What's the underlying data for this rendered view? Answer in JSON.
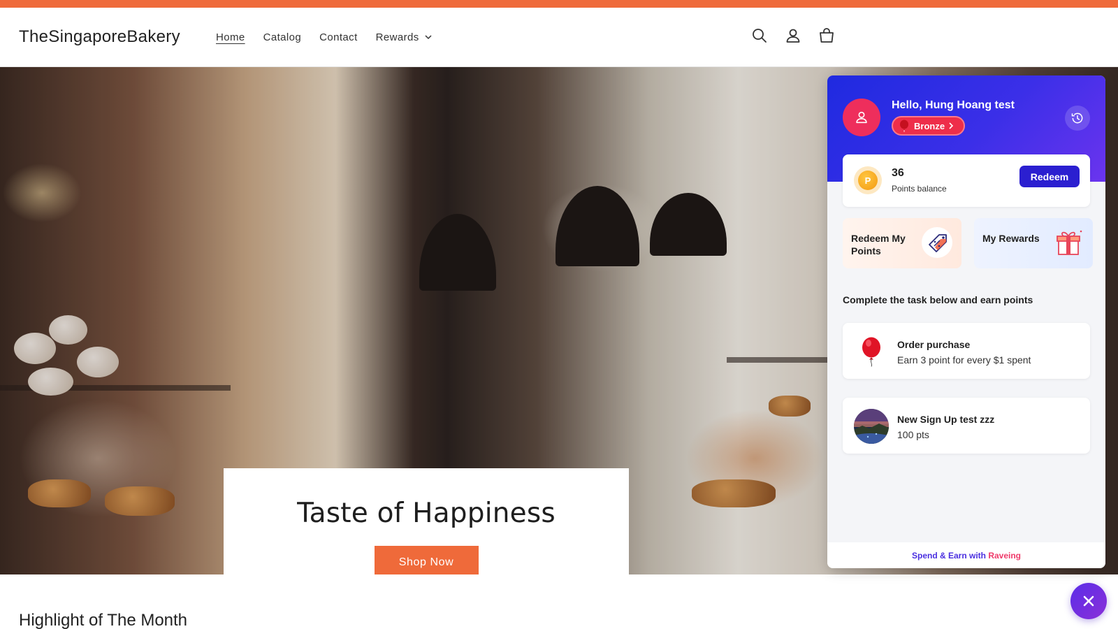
{
  "colors": {
    "accent": "#ef6a3a",
    "widget_primary": "#2b1fd0",
    "tier_red": "#ee2e4a"
  },
  "header": {
    "logo": "TheSingaporeBakery",
    "nav": [
      {
        "label": "Home",
        "active": true
      },
      {
        "label": "Catalog"
      },
      {
        "label": "Contact"
      },
      {
        "label": "Rewards",
        "has_dropdown": true
      }
    ],
    "icons": [
      "search-icon",
      "account-icon",
      "cart-icon"
    ]
  },
  "hero": {
    "title": "Taste of Happiness",
    "cta": "Shop Now"
  },
  "section": {
    "title": "Highlight of The Month"
  },
  "widget": {
    "greeting": "Hello, Hung Hoang test",
    "tier": "Bronze",
    "points": "36",
    "points_label": "Points balance",
    "redeem_button": "Redeem",
    "tiles": [
      {
        "label": "Redeem My Points",
        "icon": "discount-tag-icon"
      },
      {
        "label": "My Rewards",
        "icon": "gift-box-icon"
      }
    ],
    "tasks_heading": "Complete the task below and earn points",
    "tasks": [
      {
        "title": "Order purchase",
        "desc": "Earn 3 point for every $1 spent",
        "icon": "balloon-icon"
      },
      {
        "title": "New Sign Up test zzz",
        "desc": "100 pts",
        "icon": "landscape-thumbnail"
      }
    ],
    "footer": {
      "part1": "Spend & Earn with ",
      "part2": "Raveing"
    }
  }
}
